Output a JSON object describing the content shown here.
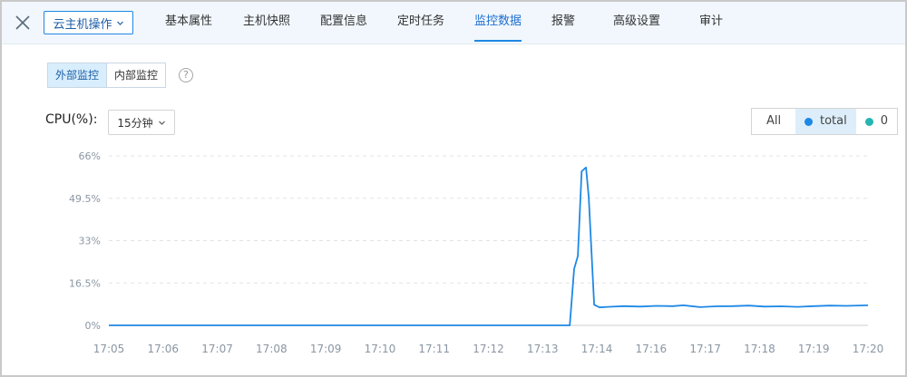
{
  "header": {
    "ops_button": "云主机操作",
    "tabs": [
      {
        "label": "基本属性",
        "active": false
      },
      {
        "label": "主机快照",
        "active": false
      },
      {
        "label": "配置信息",
        "active": false
      },
      {
        "label": "定时任务",
        "active": false
      },
      {
        "label": "监控数据",
        "active": true
      },
      {
        "label": "报警",
        "active": false
      },
      {
        "label": "高级设置",
        "active": false
      },
      {
        "label": "审计",
        "active": false
      }
    ]
  },
  "monitor": {
    "tabs": [
      {
        "label": "外部监控",
        "active": true
      },
      {
        "label": "内部监控",
        "active": false
      }
    ],
    "help": "?",
    "metric_label": "CPU(%):",
    "range_value": "15分钟"
  },
  "legend": {
    "all": "All",
    "items": [
      {
        "label": "total",
        "color": "#1e88e5",
        "selected": true
      },
      {
        "label": "0",
        "color": "#26b5b0",
        "selected": false
      }
    ]
  },
  "colors": {
    "accent": "#1e88e5",
    "line": "#1e88e5"
  },
  "chart_data": {
    "type": "line",
    "y_ticks": [
      "66%",
      "49.5%",
      "33%",
      "16.5%",
      "0%"
    ],
    "ylim": [
      0,
      66
    ],
    "x_ticks": [
      "17:05",
      "17:06",
      "17:07",
      "17:08",
      "17:09",
      "17:10",
      "17:11",
      "17:12",
      "17:13",
      "17:14",
      "17:16",
      "17:17",
      "17:18",
      "17:19",
      "17:20"
    ],
    "grid": true,
    "series": [
      {
        "name": "total",
        "x": [
          0,
          8.5,
          8.58,
          8.65,
          8.72,
          8.8,
          8.85,
          8.95,
          9.05,
          9.2,
          9.5,
          9.8,
          10.1,
          10.4,
          10.6,
          10.9,
          11.2,
          11.5,
          11.8,
          12.1,
          12.4,
          12.7,
          13,
          13.3,
          13.6,
          14
        ],
        "y": [
          0,
          0,
          22,
          27,
          60,
          61.5,
          50,
          8,
          7,
          7.2,
          7.5,
          7.3,
          7.6,
          7.5,
          7.8,
          7.1,
          7.4,
          7.5,
          7.7,
          7.3,
          7.4,
          7.2,
          7.5,
          7.7,
          7.6,
          7.8
        ]
      }
    ]
  }
}
